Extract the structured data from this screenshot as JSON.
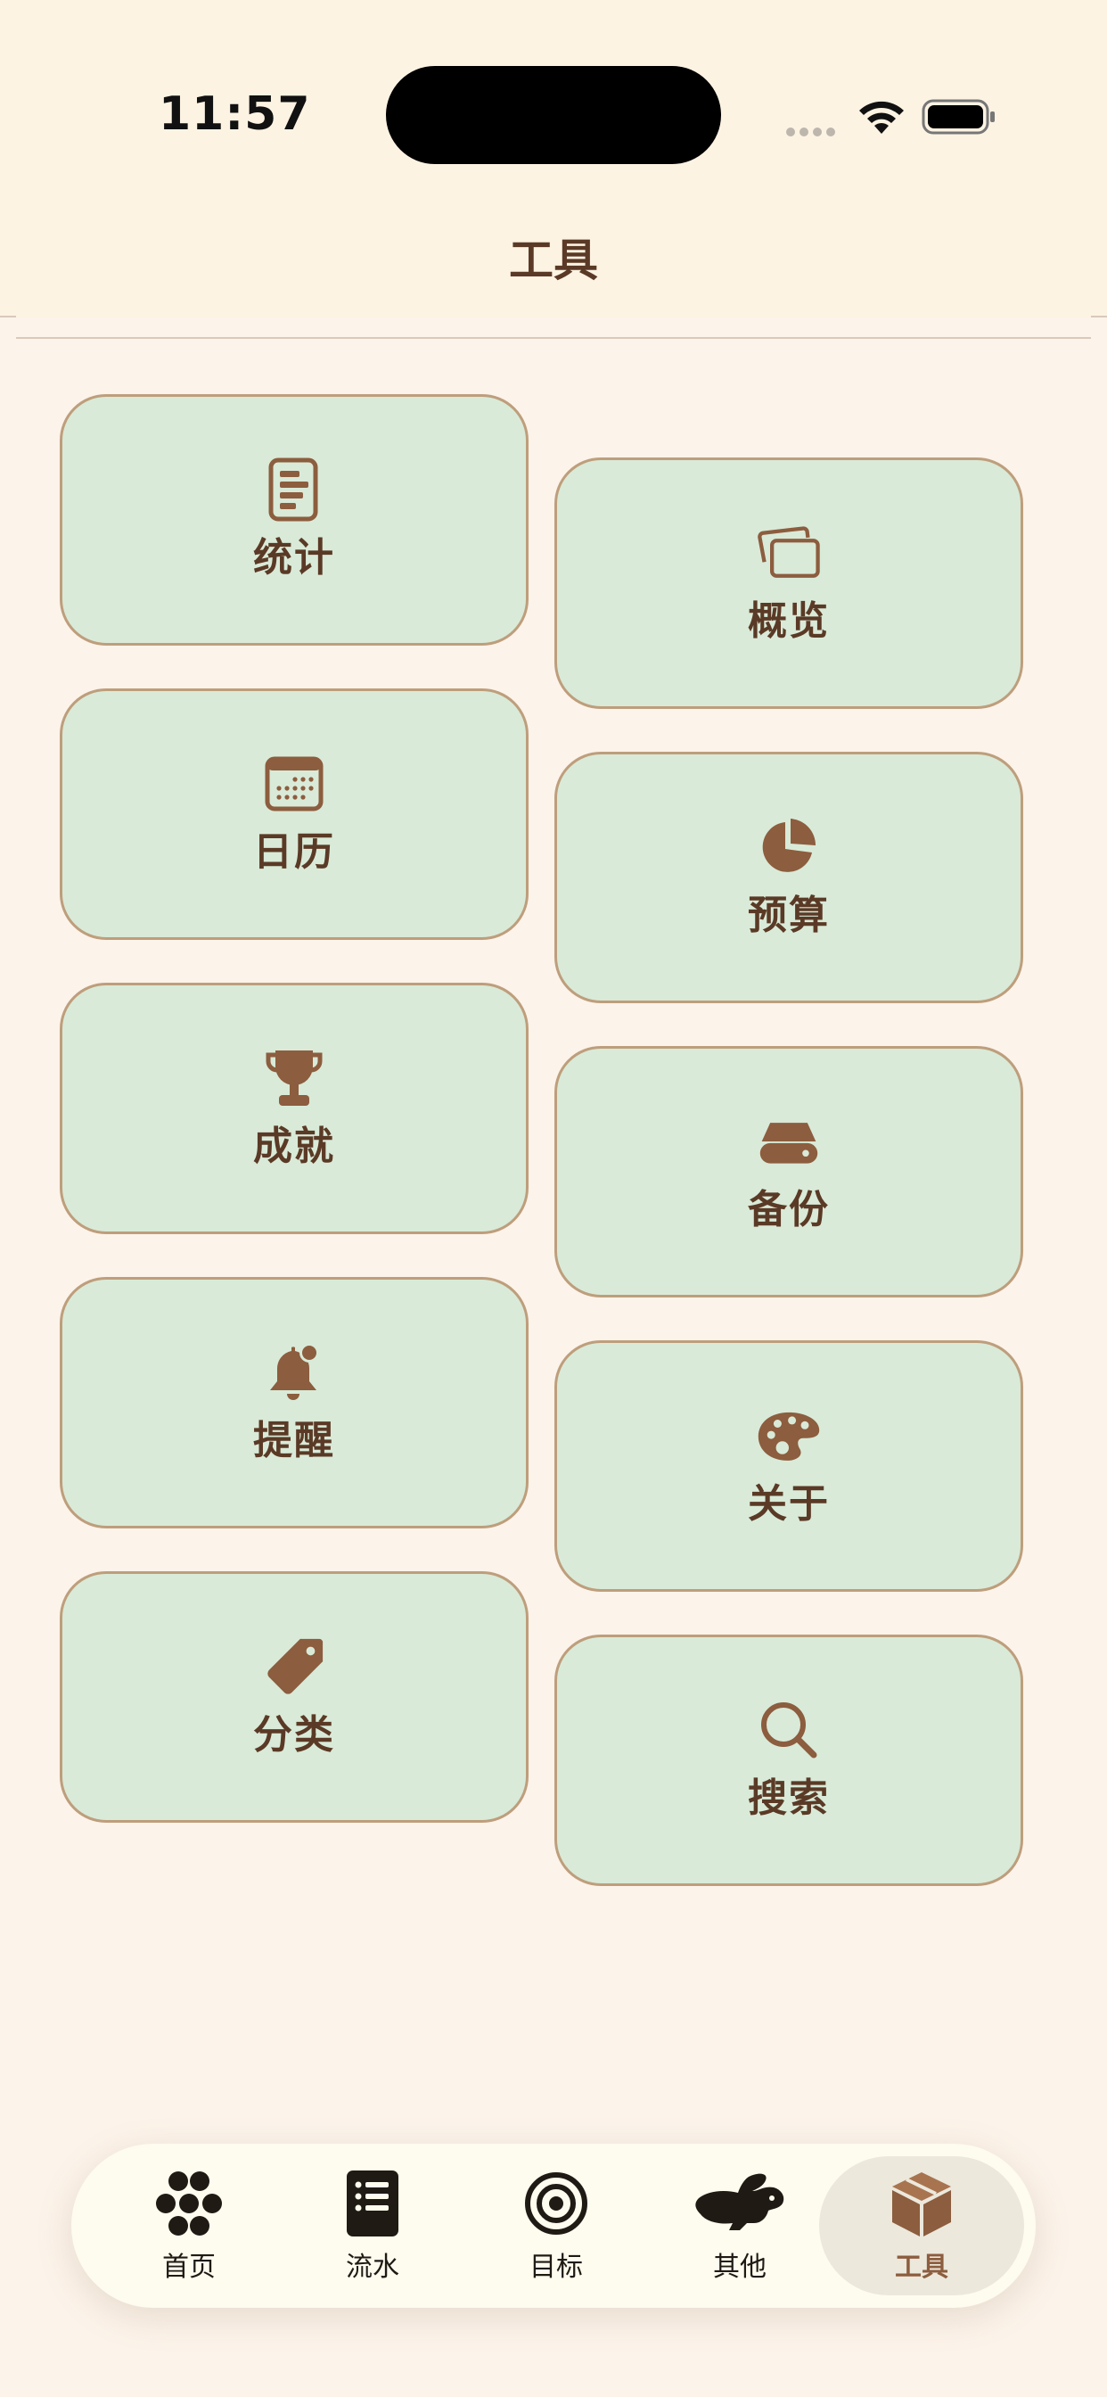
{
  "status_bar": {
    "time": "11:57"
  },
  "header": {
    "title": "工具"
  },
  "cards": [
    {
      "label": "统计",
      "icon": "document-chart-icon"
    },
    {
      "label": "概览",
      "icon": "stacked-cards-icon"
    },
    {
      "label": "日历",
      "icon": "calendar-icon"
    },
    {
      "label": "预算",
      "icon": "pie-chart-icon"
    },
    {
      "label": "成就",
      "icon": "trophy-icon"
    },
    {
      "label": "备份",
      "icon": "drive-icon"
    },
    {
      "label": "提醒",
      "icon": "bell-badge-icon"
    },
    {
      "label": "关于",
      "icon": "palette-icon"
    },
    {
      "label": "分类",
      "icon": "tag-icon"
    },
    {
      "label": "搜索",
      "icon": "search-icon"
    }
  ],
  "tabbar": {
    "items": [
      {
        "label": "首页",
        "icon": "flower-dots-icon"
      },
      {
        "label": "流水",
        "icon": "list-document-icon"
      },
      {
        "label": "目标",
        "icon": "target-icon"
      },
      {
        "label": "其他",
        "icon": "rabbit-icon"
      },
      {
        "label": "工具",
        "icon": "box-icon",
        "active": true
      }
    ]
  },
  "colors": {
    "background": "#FCF3EA",
    "header_bg": "#FDF3E3",
    "card_bg": "#D9EAD8",
    "card_border": "#BE9E7C",
    "accent_brown": "#8C5D3E",
    "text_dark": "#5A3A26"
  }
}
